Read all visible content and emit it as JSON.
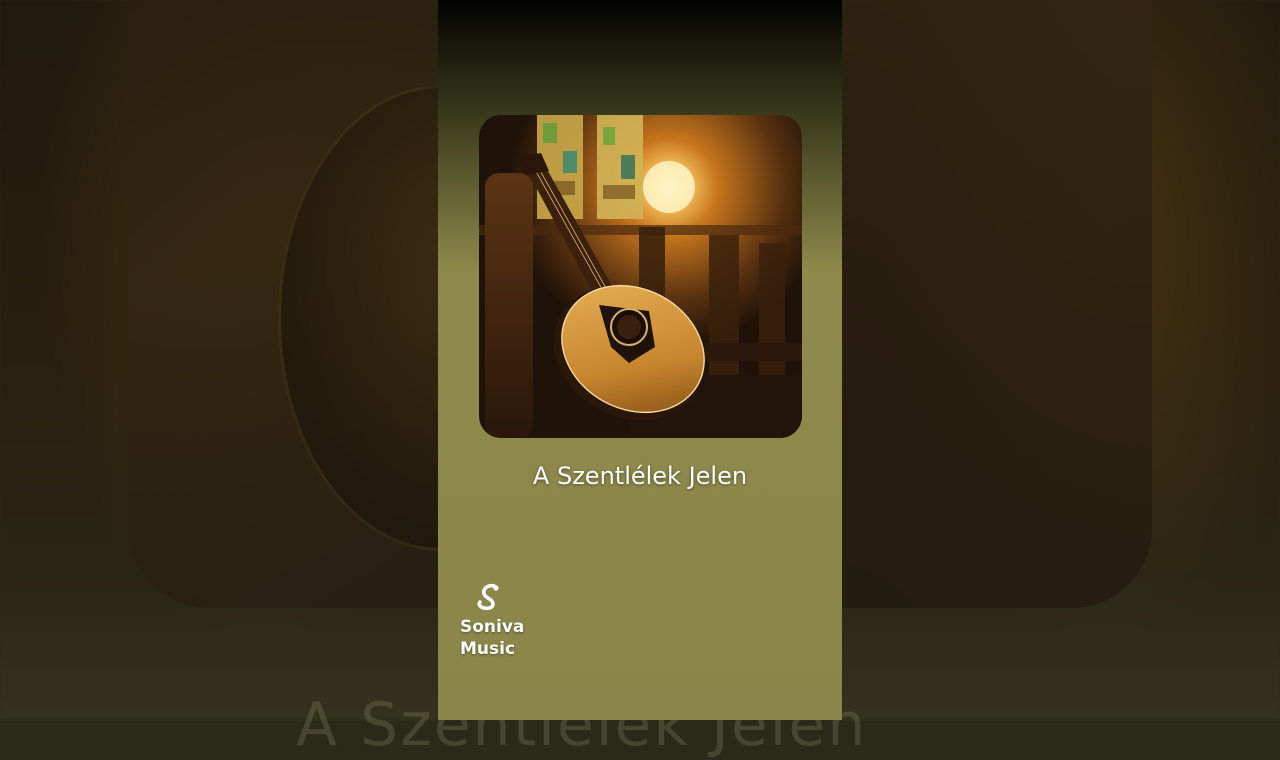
{
  "video": {
    "title": "A Szentlélek Jelen",
    "background_text": "A Szentlélek Jelen"
  },
  "channel": {
    "name_line1": "Soniva",
    "name_line2": "Music",
    "logo_icon": "soniva-s-logo-icon"
  },
  "artwork": {
    "description_icon": "guitar-in-church-artwork"
  },
  "colors": {
    "column_bg": "#8a854a",
    "title_text": "#ffffff"
  }
}
